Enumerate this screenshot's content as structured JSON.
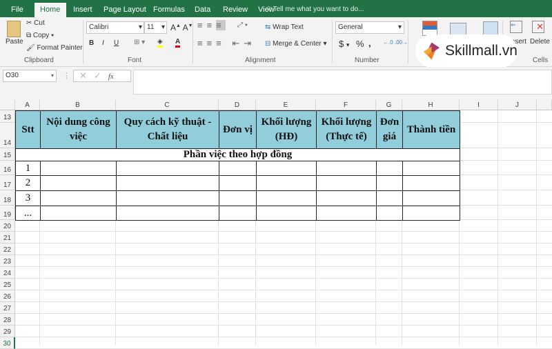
{
  "ribbon_tabs": [
    "File",
    "Home",
    "Insert",
    "Page Layout",
    "Formulas",
    "Data",
    "Review",
    "View"
  ],
  "active_tab": "Home",
  "tell_me": "Tell me what you want to do...",
  "clipboard": {
    "paste": "Paste",
    "cut": "Cut",
    "copy": "Copy",
    "format_painter": "Format Painter",
    "label": "Clipboard"
  },
  "font": {
    "name": "Calibri",
    "size": "11",
    "bold": "B",
    "italic": "I",
    "underline": "U",
    "label": "Font"
  },
  "alignment": {
    "wrap": "Wrap Text",
    "merge": "Merge & Center",
    "label": "Alignment"
  },
  "number": {
    "format": "General",
    "currency": "$",
    "percent": "%",
    "comma": ",",
    "label": "Number"
  },
  "cells": {
    "insert": "Insert",
    "delete": "Delete",
    "label": "Cells"
  },
  "watermark": "Skillmall.vn",
  "name_box": "O30",
  "formula_value": "",
  "columns": [
    "A",
    "B",
    "C",
    "D",
    "E",
    "F",
    "G",
    "H",
    "I",
    "J"
  ],
  "rows": [
    "13",
    "14",
    "15",
    "16",
    "17",
    "18",
    "19",
    "20",
    "21",
    "22",
    "23",
    "24",
    "25",
    "26",
    "27",
    "28",
    "29",
    "30"
  ],
  "table": {
    "headers": [
      "Stt",
      "Nội dung công việc",
      "Quy cách kỹ thuật - Chất liệu",
      "Đơn vị",
      "Khối lượng (HĐ)",
      "Khối lượng (Thực tế)",
      "Đơn giá",
      "Thành tiền"
    ],
    "section_title": "Phần việc theo hợp đồng",
    "stt": [
      "1",
      "2",
      "3",
      "..."
    ]
  },
  "colors": {
    "header_fill": "#92cddc",
    "ribbon_green": "#217346"
  }
}
